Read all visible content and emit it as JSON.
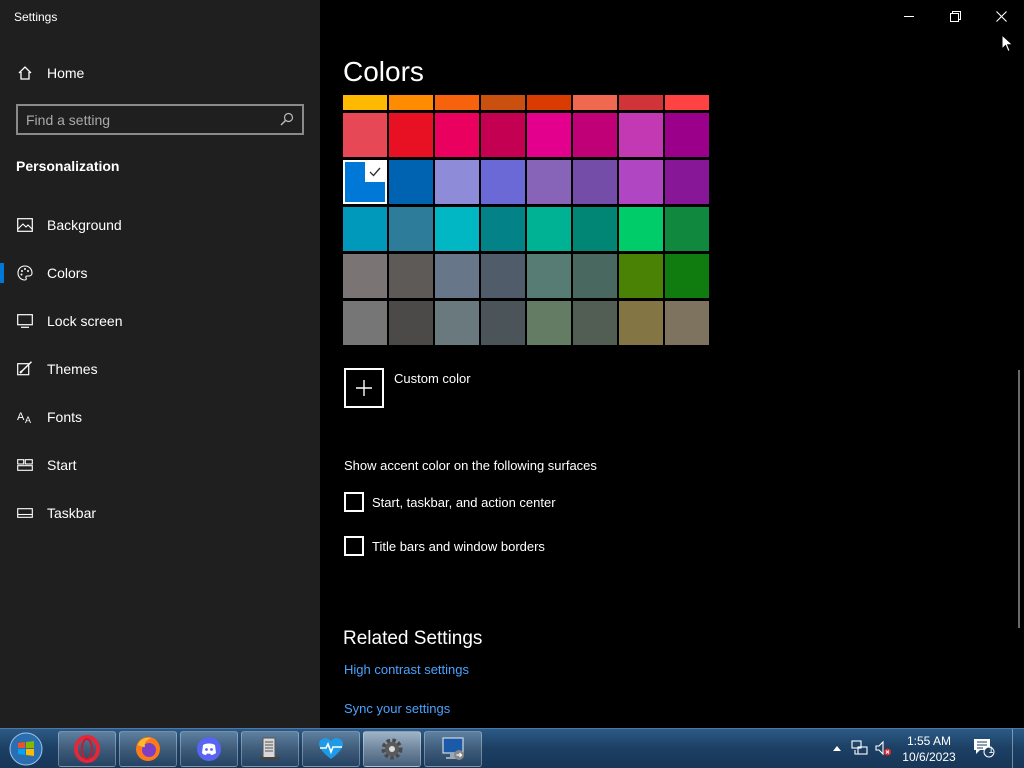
{
  "window": {
    "title": "Settings",
    "minimize_label": "Minimize",
    "restore_label": "Restore",
    "close_label": "Close"
  },
  "sidebar": {
    "home_label": "Home",
    "search_placeholder": "Find a setting",
    "section_title": "Personalization",
    "items": [
      {
        "label": "Background",
        "icon": "picture-icon",
        "selected": false
      },
      {
        "label": "Colors",
        "icon": "palette-icon",
        "selected": true
      },
      {
        "label": "Lock screen",
        "icon": "lock-screen-icon",
        "selected": false
      },
      {
        "label": "Themes",
        "icon": "brush-icon",
        "selected": false
      },
      {
        "label": "Fonts",
        "icon": "font-icon",
        "selected": false
      },
      {
        "label": "Start",
        "icon": "start-icon",
        "selected": false
      },
      {
        "label": "Taskbar",
        "icon": "taskbar-icon",
        "selected": false
      }
    ]
  },
  "main": {
    "title": "Colors",
    "swatch_rows": [
      [
        "#FFB900",
        "#FF8C00",
        "#F7630C",
        "#CA5010",
        "#DA3B01",
        "#EF6950",
        "#D13438",
        "#FF4343"
      ],
      [
        "#E74856",
        "#E81123",
        "#EA005E",
        "#C30052",
        "#E3008C",
        "#BF0077",
        "#C239B3",
        "#9A0089"
      ],
      [
        "#0078D7",
        "#0063B1",
        "#8E8CD8",
        "#6B69D6",
        "#8764B8",
        "#744DA9",
        "#B146C2",
        "#881798"
      ],
      [
        "#0099BC",
        "#2D7D9A",
        "#00B7C3",
        "#038387",
        "#00B294",
        "#018574",
        "#00CC6A",
        "#10893E"
      ],
      [
        "#7A7574",
        "#5D5A58",
        "#68768A",
        "#515C6B",
        "#567C73",
        "#486860",
        "#498205",
        "#107C10"
      ],
      [
        "#767676",
        "#4C4A48",
        "#69797E",
        "#4A5459",
        "#647C64",
        "#525E54",
        "#847545",
        "#7E735F"
      ]
    ],
    "selected_swatch": "#0078D7",
    "custom_color_label": "Custom color",
    "accent_heading": "Show accent color on the following surfaces",
    "checkboxes": [
      {
        "label": "Start, taskbar, and action center",
        "checked": false
      },
      {
        "label": "Title bars and window borders",
        "checked": false
      }
    ],
    "related_title": "Related Settings",
    "links": [
      "High contrast settings",
      "Sync your settings"
    ]
  },
  "taskbar": {
    "apps": [
      {
        "name": "opera-icon",
        "active": false
      },
      {
        "name": "firefox-icon",
        "active": false
      },
      {
        "name": "discord-icon",
        "active": false
      },
      {
        "name": "file-manager-icon",
        "active": false
      },
      {
        "name": "health-monitor-icon",
        "active": false
      },
      {
        "name": "settings-gear-icon",
        "active": true
      },
      {
        "name": "remote-desktop-icon",
        "active": false
      }
    ],
    "tray": {
      "time": "1:55 AM",
      "date": "10/6/2023",
      "notification_count": "1"
    }
  },
  "colors": {
    "accent": "#0078D7",
    "sidebar_bg": "#1F1F1F",
    "link": "#4AA3FF"
  }
}
